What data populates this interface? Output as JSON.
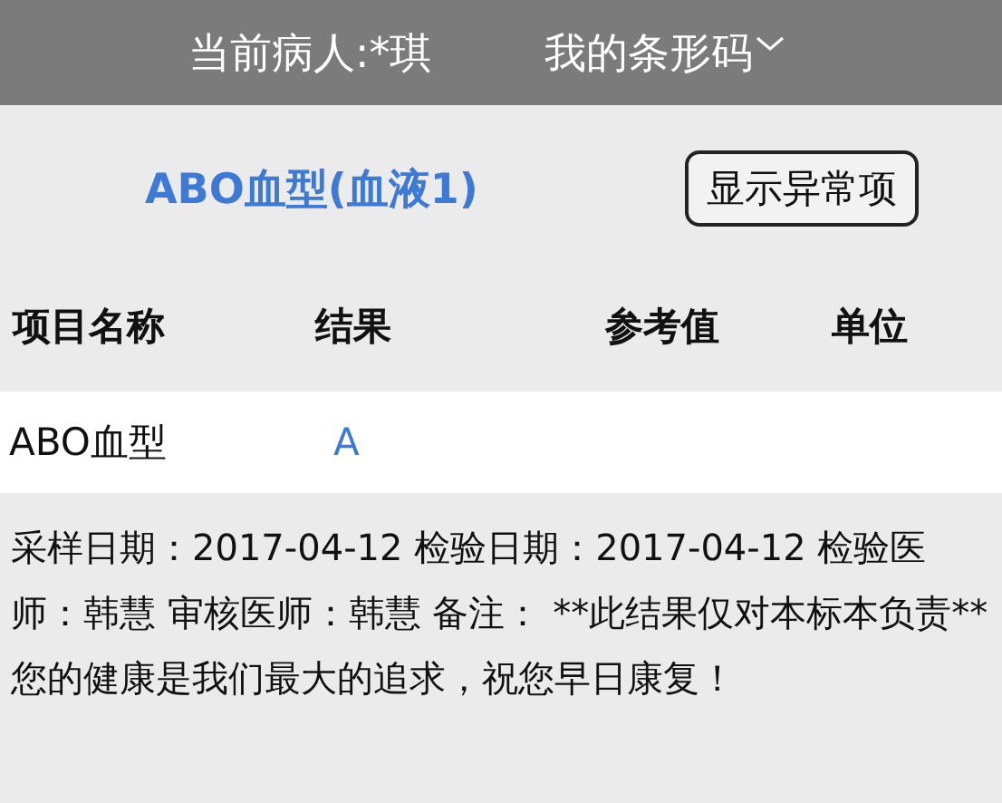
{
  "header": {
    "patient": "当前病人:*琪",
    "barcode_menu": "我的条形码"
  },
  "title": "ABO血型(血液1)",
  "filter_button": "显示异常项",
  "columns": [
    "项目名称",
    "结果",
    "参考值",
    "单位"
  ],
  "rows": [
    {
      "name": "ABO血型",
      "result": "A"
    }
  ],
  "note": "采样日期：2017-04-12 检验日期：2017-04-12 检验医师：韩慧 审核医师：韩慧 备注： **此结果仅对本标本负责** 您的健康是我们最大的追求，祝您早日康复！"
}
